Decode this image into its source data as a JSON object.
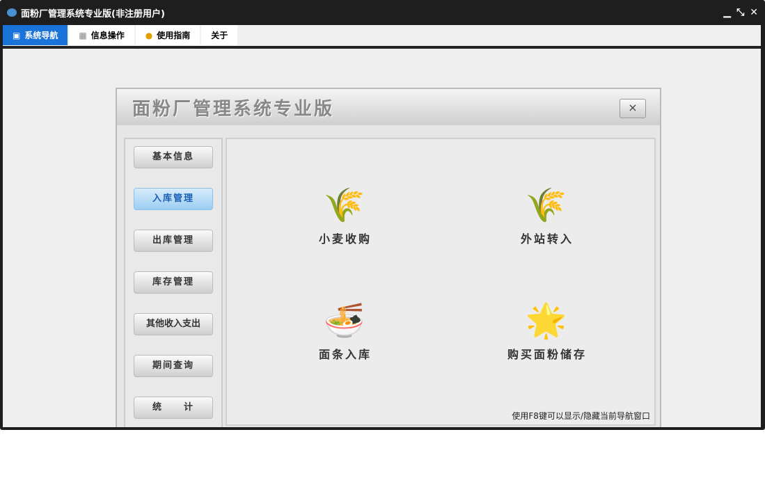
{
  "window": {
    "title": "面粉厂管理系统专业版(非注册用户)"
  },
  "tabs": [
    {
      "label": "系统导航"
    },
    {
      "label": "信息操作"
    },
    {
      "label": "使用指南"
    },
    {
      "label": "关于"
    }
  ],
  "panel": {
    "title": "面粉厂管理系统专业版",
    "close": "×"
  },
  "nav": [
    "基本信息",
    "入库管理",
    "出库管理",
    "库存管理",
    "其他收入支出",
    "期间查询",
    "统　　计"
  ],
  "items": [
    {
      "label": "小麦收购",
      "icon": "🌾"
    },
    {
      "label": "外站转入",
      "icon": "🌾"
    },
    {
      "label": "面条入库",
      "icon": "🍜"
    },
    {
      "label": "购买面粉储存",
      "icon": "🌟"
    }
  ],
  "hint": "使用F8键可以显示/隐藏当前导航窗口"
}
